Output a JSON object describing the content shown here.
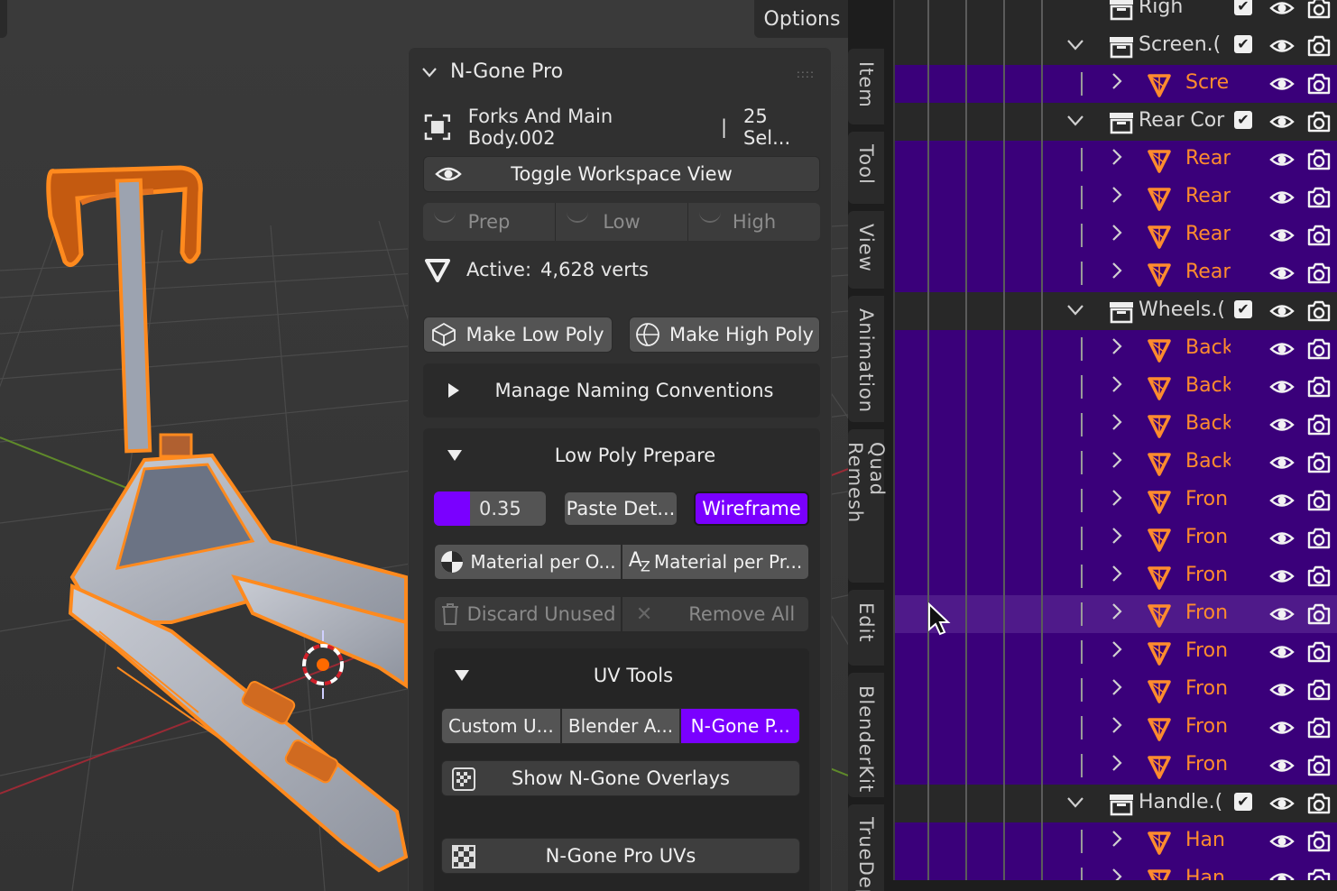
{
  "viewport": {
    "options_label": "Options"
  },
  "tabs": [
    "Item",
    "Tool",
    "View",
    "Animation",
    "Quad Remesh",
    "Edit",
    "BlenderKit",
    "TrueDep"
  ],
  "panel": {
    "title": "N-Gone Pro",
    "object_name": "Forks And Main Body.002",
    "separator": "|",
    "selection": "25 Sel...",
    "toggle_view": "Toggle Workspace View",
    "stages": [
      "Prep",
      "Low",
      "High"
    ],
    "active_label": "Active:",
    "active_value": "4,628 verts",
    "make_low": "Make Low Poly",
    "make_high": "Make High Poly",
    "manage_naming": "Manage Naming Conventions",
    "low_poly_prepare": {
      "title": "Low Poly Prepare",
      "value": "0.35",
      "paste": "Paste Det...",
      "wireframe": "Wireframe",
      "mat_obj": "Material per O...",
      "mat_pr": "Material per Pr...",
      "discard": "Discard Unused",
      "remove_all": "Remove All"
    },
    "uv_tools": {
      "title": "UV Tools",
      "options": [
        "Custom U...",
        "Blender A...",
        "N-Gone P..."
      ],
      "selected": "N-Gone P...",
      "show_overlays": "Show N-Gone Overlays",
      "pro_uvs": "N-Gone Pro UVs"
    }
  },
  "outliner": {
    "rows": [
      {
        "kind": "collection",
        "name": "Righ"
      },
      {
        "kind": "collection",
        "name": "Screen.("
      },
      {
        "kind": "mesh",
        "name": "Scre"
      },
      {
        "kind": "collection",
        "name": "Rear Cor"
      },
      {
        "kind": "mesh",
        "name": "Rear"
      },
      {
        "kind": "mesh",
        "name": "Rear"
      },
      {
        "kind": "mesh",
        "name": "Rear"
      },
      {
        "kind": "mesh",
        "name": "Rear"
      },
      {
        "kind": "collection",
        "name": "Wheels.("
      },
      {
        "kind": "mesh",
        "name": "Back"
      },
      {
        "kind": "mesh",
        "name": "Back"
      },
      {
        "kind": "mesh",
        "name": "Back"
      },
      {
        "kind": "mesh",
        "name": "Back"
      },
      {
        "kind": "mesh",
        "name": "Fron"
      },
      {
        "kind": "mesh",
        "name": "Fron"
      },
      {
        "kind": "mesh",
        "name": "Fron"
      },
      {
        "kind": "mesh",
        "name": "Fron"
      },
      {
        "kind": "mesh",
        "name": "Fron"
      },
      {
        "kind": "mesh",
        "name": "Fron"
      },
      {
        "kind": "mesh",
        "name": "Fron"
      },
      {
        "kind": "mesh",
        "name": "Fron"
      },
      {
        "kind": "collection",
        "name": "Handle.("
      },
      {
        "kind": "mesh",
        "name": "Han"
      },
      {
        "kind": "mesh",
        "name": "Han"
      }
    ]
  },
  "colors": {
    "accent": "#7a00ff",
    "selection_orange": "#ff8c2e",
    "outliner_selected": "#3a007a"
  }
}
